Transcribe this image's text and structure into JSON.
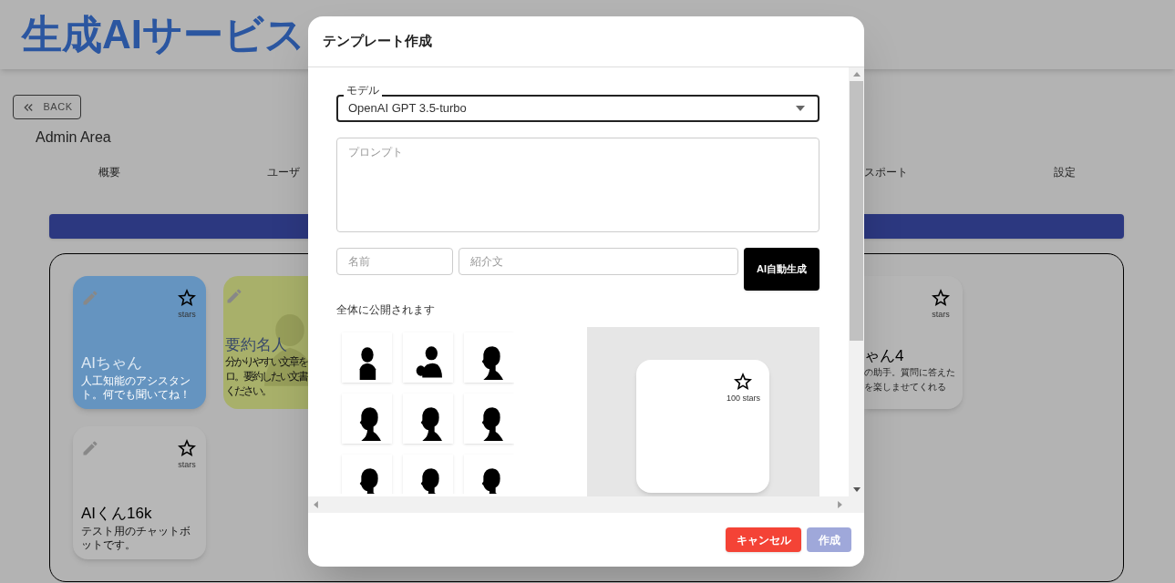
{
  "header": {
    "title": "生成AIサービス"
  },
  "back_button": {
    "label": "BACK"
  },
  "section_title": "Admin Area",
  "tabs": [
    {
      "label": "概要"
    },
    {
      "label": "ユーザ"
    },
    {
      "label": "スポート"
    },
    {
      "label": "設定"
    }
  ],
  "cards": [
    {
      "kind": "full",
      "name": "AIちゃん",
      "description": "人工知能のアシスタント。何でも聞いてね！",
      "star_label": "stars",
      "color": "#6594c0"
    },
    {
      "kind": "left_part",
      "name": "要約名人",
      "description_lines": [
        "分かりやすい文章を",
        "ロ。要約したい文書",
        "ください。"
      ],
      "color": "#a8b06a"
    },
    {
      "kind": "right_part",
      "name": "ゃん4",
      "description_lines": [
        "の助手。質問に答えた",
        "を楽しませてくれる"
      ],
      "star_label": "stars",
      "color": "#b6b6b6"
    },
    {
      "kind": "full",
      "name": "AIくん16k",
      "description": "テスト用のチャットボットです。",
      "star_label": "stars",
      "color": "#b7b7b7"
    }
  ],
  "dialog": {
    "title": "テンプレート作成",
    "model_select": {
      "label": "モデル",
      "value": "OpenAI GPT 3.5-turbo"
    },
    "prompt_field": {
      "placeholder": "プロンプト"
    },
    "name_field": {
      "placeholder": "名前"
    },
    "intro_field": {
      "placeholder": "紹介文"
    },
    "generate_button": {
      "label": "AI自動生成"
    },
    "visibility_note": "全体に公開されます",
    "avatars": [
      {
        "kind": "suit"
      },
      {
        "kind": "hand"
      },
      {
        "kind": "profile"
      },
      {
        "kind": "profile"
      },
      {
        "kind": "profile"
      },
      {
        "kind": "profile"
      },
      {
        "kind": "profile"
      },
      {
        "kind": "profile"
      },
      {
        "kind": "profile"
      }
    ],
    "preview": {
      "star_label": "100 stars"
    },
    "buttons": [
      {
        "label": "キャンセル",
        "kind": "cancel",
        "disabled": false
      },
      {
        "label": "作成",
        "kind": "submit",
        "disabled": true
      }
    ]
  }
}
